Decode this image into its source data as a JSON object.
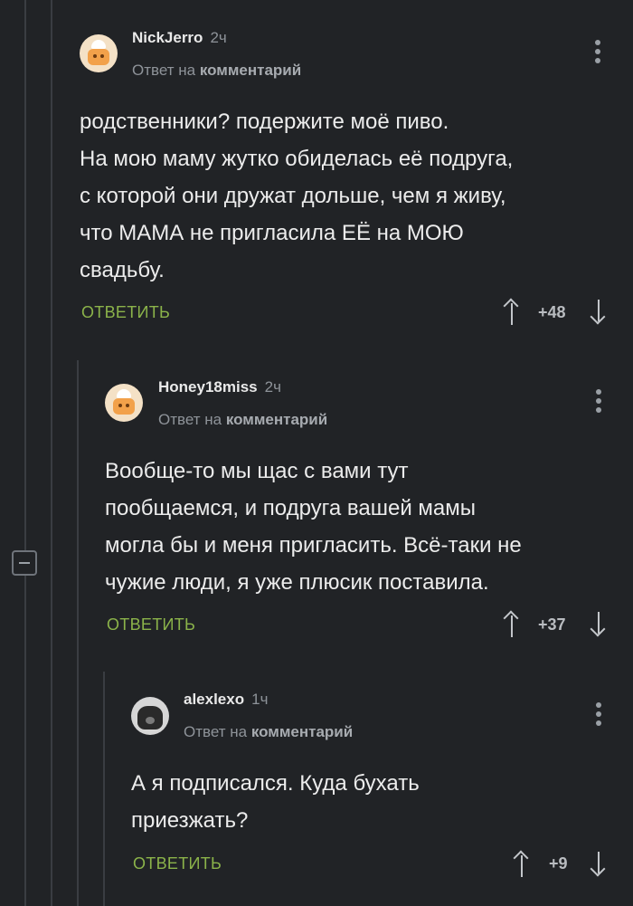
{
  "comments": [
    {
      "author": "NickJerro",
      "time": "2ч",
      "reply_prefix": "Ответ на",
      "reply_target": "комментарий",
      "text": "родственники? подержите моё пиво.\nНа мою маму жутко обиделась её подруга,\nс которой они дружат дольше, чем я живу,\nчто МАМА не пригласила ЕЁ на МОЮ\nсвадьбу.",
      "reply_label": "ОТВЕТИТЬ",
      "score": "+48"
    },
    {
      "author": "Honey18miss",
      "time": "2ч",
      "reply_prefix": "Ответ на",
      "reply_target": "комментарий",
      "text": "Вообще-то мы щас с вами тут\nпообщаемся, и подруга вашей мамы\nмогла бы и меня пригласить. Всё-таки не\nчужие люди, я уже плюсик поставила.",
      "reply_label": "ОТВЕТИТЬ",
      "score": "+37"
    },
    {
      "author": "alexlexo",
      "time": "1ч",
      "reply_prefix": "Ответ на",
      "reply_target": "комментарий",
      "text": "А я подписался. Куда бухать\nприезжать?",
      "reply_label": "ОТВЕТИТЬ",
      "score": "+9"
    }
  ],
  "colors": {
    "background": "#212326",
    "reply_button": "#8bb34a",
    "thread_line": "#3a3d42"
  },
  "icons": {
    "collapse": "minus-box-icon",
    "menu": "kebab-menu-icon",
    "upvote": "arrow-up-icon",
    "downvote": "arrow-down-icon"
  }
}
